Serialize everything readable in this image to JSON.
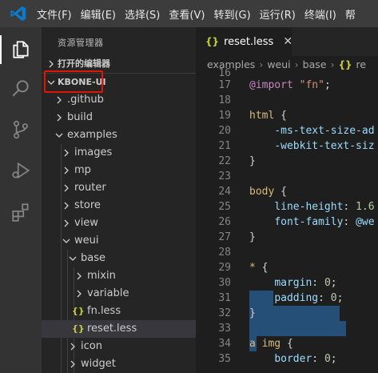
{
  "menu": [
    "文件(F)",
    "编辑(E)",
    "选择(S)",
    "查看(V)",
    "转到(G)",
    "运行(R)",
    "终端(I)",
    "帮"
  ],
  "sidebar": {
    "title": "资源管理器",
    "open_editors": "打开的编辑器",
    "project": "KBONE-UI",
    "tree": [
      {
        "label": ".github",
        "type": "folder",
        "expanded": false
      },
      {
        "label": "build",
        "type": "folder",
        "expanded": false
      },
      {
        "label": "examples",
        "type": "folder",
        "expanded": true
      },
      {
        "label": "images",
        "type": "folder",
        "expanded": false
      },
      {
        "label": "mp",
        "type": "folder",
        "expanded": false
      },
      {
        "label": "router",
        "type": "folder",
        "expanded": false
      },
      {
        "label": "store",
        "type": "folder",
        "expanded": false
      },
      {
        "label": "view",
        "type": "folder",
        "expanded": false
      },
      {
        "label": "weui",
        "type": "folder",
        "expanded": true
      },
      {
        "label": "base",
        "type": "folder",
        "expanded": true
      },
      {
        "label": "mixin",
        "type": "folder",
        "expanded": false
      },
      {
        "label": "variable",
        "type": "folder",
        "expanded": false
      },
      {
        "label": "fn.less",
        "type": "file",
        "icon": "{}"
      },
      {
        "label": "reset.less",
        "type": "file",
        "icon": "{}",
        "selected": true
      },
      {
        "label": "icon",
        "type": "folder",
        "expanded": false
      },
      {
        "label": "widget",
        "type": "folder",
        "expanded": false
      }
    ]
  },
  "editor": {
    "tab": {
      "icon": "{}",
      "label": "reset.less",
      "close": "✕"
    },
    "breadcrumb": [
      "examples",
      "weui",
      "base",
      "{}",
      "re"
    ],
    "partial_line_number": "16",
    "lines": [
      {
        "n": "17",
        "code": "@import \"fn\";"
      },
      {
        "n": "18",
        "code": ""
      },
      {
        "n": "19",
        "code": "html {"
      },
      {
        "n": "20",
        "code": "    -ms-text-size-ad"
      },
      {
        "n": "21",
        "code": "    -webkit-text-siz"
      },
      {
        "n": "22",
        "code": "}"
      },
      {
        "n": "23",
        "code": ""
      },
      {
        "n": "24",
        "code": "body {"
      },
      {
        "n": "25",
        "code": "    line-height: 1.6"
      },
      {
        "n": "26",
        "code": "    font-family: @we"
      },
      {
        "n": "27",
        "code": "}"
      },
      {
        "n": "28",
        "code": ""
      },
      {
        "n": "29",
        "code": "* {"
      },
      {
        "n": "30",
        "code": "    margin: 0;"
      },
      {
        "n": "31",
        "code": "    padding: 0;"
      },
      {
        "n": "32",
        "code": "}"
      },
      {
        "n": "33",
        "code": ""
      },
      {
        "n": "34",
        "code": "a img {"
      },
      {
        "n": "35",
        "code": "    border: 0;"
      }
    ]
  },
  "colors": {
    "accent": "#0e639c",
    "highlight_box": "#e51400",
    "selection": "#264f78"
  }
}
